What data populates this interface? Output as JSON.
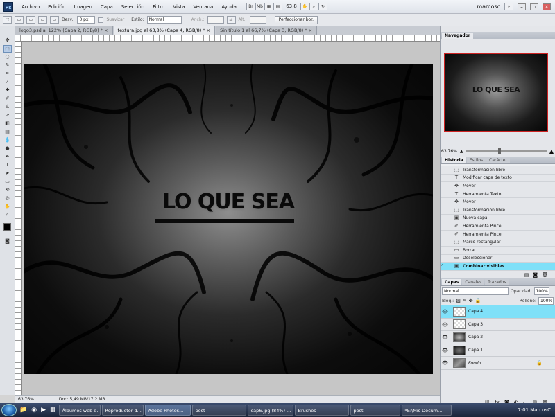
{
  "menubar": {
    "logo": "Ps",
    "items": [
      "Archivo",
      "Edición",
      "Imagen",
      "Capa",
      "Selección",
      "Filtro",
      "Vista",
      "Ventana",
      "Ayuda"
    ],
    "zoom": "63,8",
    "user": "marcosc"
  },
  "options": {
    "feather_label": "Desv.:",
    "feather_value": "0 px",
    "antialias_label": "Suavizar",
    "style_label": "Estilo:",
    "style_value": "Normal",
    "width_label": "Anch.:",
    "height_label": "Alt.:",
    "refine_button": "Perfeccionar bor."
  },
  "tabs": [
    {
      "label": "logo3.psd al 122% (Capa 2, RGB/8) *"
    },
    {
      "label": "textura.jpg al 63,8% (Capa 4, RGB/8) *"
    },
    {
      "label": "Sin título 1 al 66,7% (Capa 3, RGB/8) *"
    }
  ],
  "artwork": {
    "text": "LO QUE SEA"
  },
  "status": {
    "zoom": "63,76%",
    "doc": "Doc: 5,49 MB/17,2 MB"
  },
  "navigator": {
    "title": "Navegador",
    "zoom": "63,76%",
    "preview_text": "LO QUE SEA"
  },
  "history": {
    "tabs": [
      "Historia",
      "Estilos",
      "Carácter"
    ],
    "items": [
      {
        "icon": "transform",
        "label": "Transformación libre"
      },
      {
        "icon": "text",
        "label": "Modificar capa de texto"
      },
      {
        "icon": "move",
        "label": "Mover"
      },
      {
        "icon": "text",
        "label": "Herramienta Texto"
      },
      {
        "icon": "move",
        "label": "Mover"
      },
      {
        "icon": "transform",
        "label": "Transformación libre"
      },
      {
        "icon": "new-layer",
        "label": "Nueva capa"
      },
      {
        "icon": "brush",
        "label": "Herramienta Pincel"
      },
      {
        "icon": "brush",
        "label": "Herramienta Pincel"
      },
      {
        "icon": "marquee",
        "label": "Marco rectangular"
      },
      {
        "icon": "erase",
        "label": "Borrar"
      },
      {
        "icon": "deselect",
        "label": "Deseleccionar"
      },
      {
        "icon": "merge",
        "label": "Combinar visibles"
      }
    ]
  },
  "layers": {
    "tabs": [
      "Capas",
      "Canales",
      "Trazados"
    ],
    "blend_mode": "Normal",
    "opacity_label": "Opacidad:",
    "opacity_value": "100%",
    "lock_label": "Bloq.:",
    "fill_label": "Relleno:",
    "fill_value": "100%",
    "items": [
      {
        "name": "Capa 4"
      },
      {
        "name": "Capa 3"
      },
      {
        "name": "Capa 2"
      },
      {
        "name": "Capa 1"
      },
      {
        "name": "Fondo"
      }
    ]
  },
  "taskbar": {
    "items": [
      "Álbumes web d...",
      "Reproductor d...",
      "Adobe Photos...",
      "post",
      "cap6.jpg (84%) ...",
      "Brushes",
      "post",
      "*E:\\Mis Docum..."
    ],
    "clock": "7:01",
    "user": "MarcosC"
  },
  "colors": {
    "selection": "#7fe0f8",
    "accent": "#c22222"
  }
}
